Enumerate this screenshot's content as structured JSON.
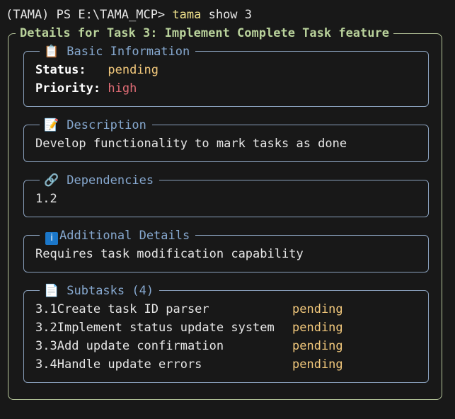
{
  "terminal": {
    "prompt": "(TAMA) PS E:\\TAMA_MCP> ",
    "command": "tama",
    "args": " show 3"
  },
  "details": {
    "title": "Details for Task 3: Implement Complete Task feature"
  },
  "basic_info": {
    "icon": "clipboard-icon",
    "icon_glyph": "📋",
    "title": "Basic Information",
    "status_label": "Status:",
    "status_value": "pending",
    "priority_label": "Priority:",
    "priority_value": "high"
  },
  "description": {
    "icon": "memo-icon",
    "icon_glyph": "📝",
    "title": "Description",
    "text": "Develop functionality to mark tasks as done"
  },
  "dependencies": {
    "icon": "link-icon",
    "icon_glyph": "🔗",
    "title": "Dependencies",
    "text": "1.2"
  },
  "additional": {
    "icon": "info-icon",
    "icon_glyph": "i",
    "title": "Additional Details",
    "text": "Requires task modification capability"
  },
  "subtasks": {
    "icon": "document-icon",
    "icon_glyph": "📄",
    "title": "Subtasks (4)",
    "items": [
      {
        "id": "3.1",
        "name": "Create task ID parser",
        "status": "pending"
      },
      {
        "id": "3.2",
        "name": "Implement status update system",
        "status": "pending"
      },
      {
        "id": "3.3",
        "name": "Add update confirmation",
        "status": "pending"
      },
      {
        "id": "3.4",
        "name": "Handle update errors",
        "status": "pending"
      }
    ]
  },
  "colors": {
    "background": "#181818",
    "outer_border": "#b5c59a",
    "outer_title": "#b9d29b",
    "panel_border": "#8aa1bd",
    "panel_title": "#86a8cf",
    "pending": "#f3c97c",
    "high": "#e06c75",
    "command": "#f0e28c"
  }
}
